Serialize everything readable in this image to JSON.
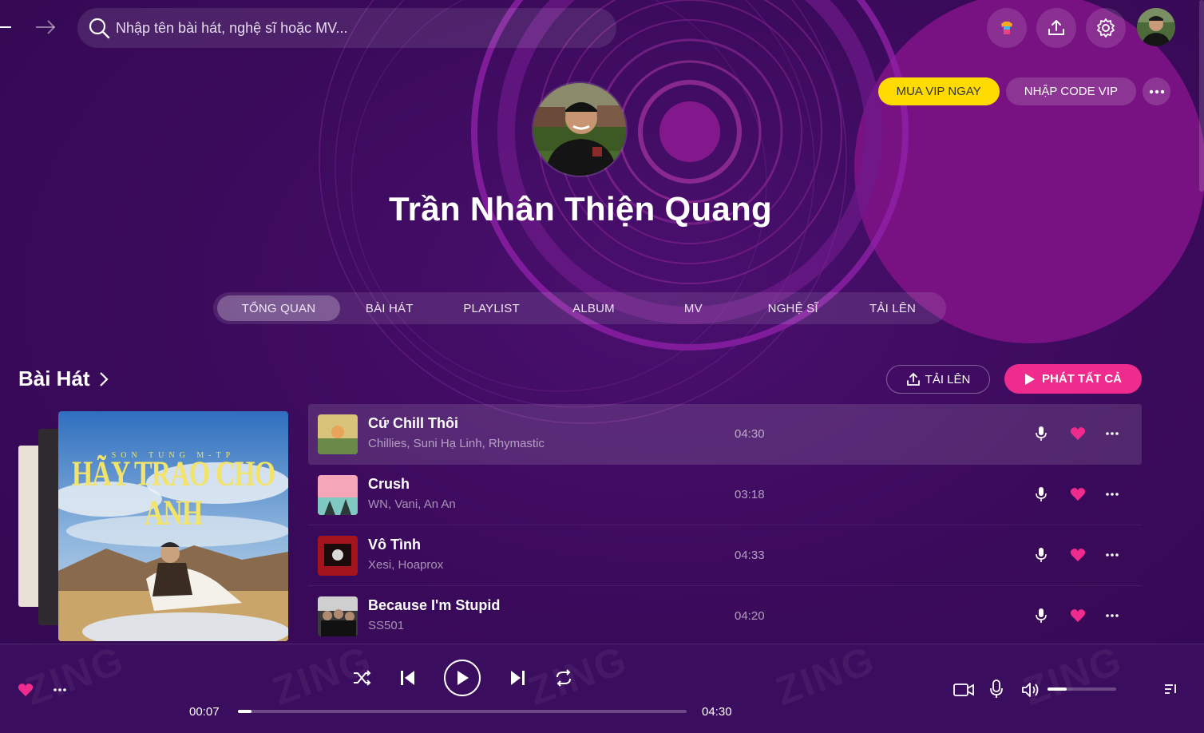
{
  "search": {
    "placeholder": "Nhập tên bài hát, nghệ sĩ hoặc MV..."
  },
  "vip": {
    "buy_label": "MUA VIP NGAY",
    "code_label": "NHẬP CODE VIP"
  },
  "profile": {
    "name": "Trần Nhân Thiện Quang"
  },
  "tabs": [
    {
      "label": "TỔNG QUAN",
      "active": true
    },
    {
      "label": "BÀI HÁT"
    },
    {
      "label": "PLAYLIST"
    },
    {
      "label": "ALBUM"
    },
    {
      "label": "MV"
    },
    {
      "label": "NGHỆ SĨ"
    },
    {
      "label": "TẢI LÊN"
    }
  ],
  "section": {
    "title": "Bài Hát",
    "upload_label": "TẢI LÊN",
    "play_all_label": "PHÁT TẤT CẢ"
  },
  "cover": {
    "artist_text": "SON TUNG M-TP",
    "title_text": "HÃY TRAO CHO ANH"
  },
  "songs": [
    {
      "title": "Cứ Chill Thôi",
      "artist": "Chillies, Suni Hạ Linh, Rhymastic",
      "duration": "04:30",
      "thumb_color": "#d9c27a"
    },
    {
      "title": "Crush",
      "artist": "WN, Vani, An An",
      "duration": "03:18",
      "thumb_color": "#f3a7b8"
    },
    {
      "title": "Vô Tình",
      "artist": "Xesi, Hoaprox",
      "duration": "04:33",
      "thumb_color": "#a3141c"
    },
    {
      "title": "Because I'm Stupid",
      "artist": "SS501",
      "duration": "04:20",
      "thumb_color": "#3a3a3a"
    }
  ],
  "player": {
    "current_time": "00:07",
    "total_time": "04:30",
    "progress": 0.03,
    "volume": 0.28
  },
  "colors": {
    "accent": "#ef2b8e",
    "vip": "#ffdb00",
    "background": "#3b0b5c"
  }
}
